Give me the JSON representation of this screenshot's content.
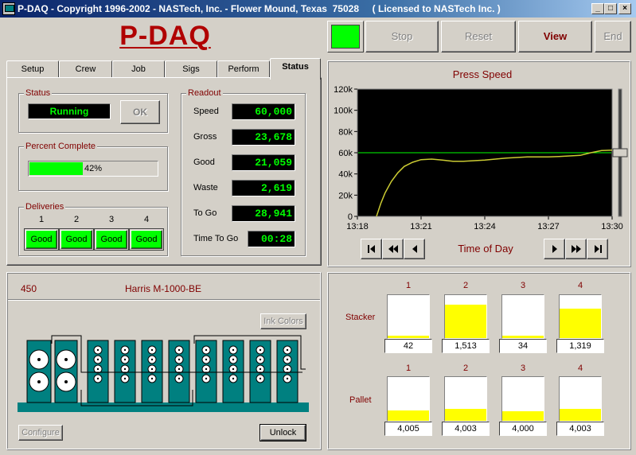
{
  "window": {
    "title": "P-DAQ - Copyright 1996-2002 - NASTech, Inc. - Flower Mound, Texas  75028     ( Licensed to NASTech Inc. )",
    "controls": [
      "minimize-icon",
      "maximize-icon",
      "close-icon"
    ]
  },
  "app_logo": "P-DAQ",
  "toolbar": {
    "indicator_color": "#00ff00",
    "stop": "Stop",
    "reset": "Reset",
    "view": "View",
    "end": "End"
  },
  "tabs": [
    "Setup",
    "Crew",
    "Job",
    "Sigs",
    "Perform",
    "Status"
  ],
  "active_tab": "Status",
  "status": {
    "group_label": "Status",
    "value": "Running",
    "ok_label": "OK"
  },
  "percent": {
    "group_label": "Percent Complete",
    "value": 42,
    "text": "42%"
  },
  "deliveries": {
    "group_label": "Deliveries",
    "items": [
      {
        "number": "1",
        "state": "Good"
      },
      {
        "number": "2",
        "state": "Good"
      },
      {
        "number": "3",
        "state": "Good"
      },
      {
        "number": "4",
        "state": "Good"
      }
    ]
  },
  "readout": {
    "group_label": "Readout",
    "rows": [
      {
        "label": "Speed",
        "value": "60,000"
      },
      {
        "label": "Gross",
        "value": "23,678"
      },
      {
        "label": "Good",
        "value": "21,059"
      },
      {
        "label": "Waste",
        "value": "2,619"
      },
      {
        "label": "To Go",
        "value": "28,941"
      },
      {
        "label": "Time To Go",
        "value": "00:28"
      }
    ]
  },
  "press": {
    "number": "450",
    "model": "Harris M-1000-BE",
    "ink_colors": "Ink Colors",
    "configure": "Configure",
    "unlock": "Unlock",
    "unit_color": "#008080"
  },
  "chart_data": {
    "type": "line",
    "title": "Press Speed",
    "xlabel": "Time of Day",
    "ylabel": "",
    "x_ticks": [
      "13:18",
      "13:21",
      "13:24",
      "13:27",
      "13:30"
    ],
    "y_ticks": [
      "0",
      "20k",
      "40k",
      "60k",
      "80k",
      "100k",
      "120k"
    ],
    "ylim": [
      0,
      120000
    ],
    "xlim_minutes": [
      0,
      12
    ],
    "background": "#000000",
    "grid": false,
    "setpoint": {
      "value": 60000,
      "color": "#00ff00"
    },
    "series": [
      {
        "color": "#cccc33",
        "x_minutes": [
          0.9,
          1.1,
          1.3,
          1.6,
          1.9,
          2.2,
          2.6,
          3.0,
          3.5,
          4.0,
          4.5,
          5.0,
          5.5,
          6.0,
          6.5,
          7.0,
          7.5,
          8.0,
          8.5,
          9.0,
          9.5,
          10.0,
          10.5,
          11.0,
          11.5,
          12.0
        ],
        "values": [
          0,
          12000,
          22000,
          33000,
          41000,
          47000,
          51000,
          53500,
          54000,
          53000,
          52000,
          52000,
          52500,
          53000,
          54000,
          55000,
          55500,
          56000,
          56000,
          56000,
          56500,
          57000,
          57500,
          60000,
          62000,
          62500
        ]
      }
    ]
  },
  "stacker": {
    "label": "Stacker",
    "columns": [
      {
        "number": "1",
        "value": "42",
        "fill": 0.06
      },
      {
        "number": "2",
        "value": "1,513",
        "fill": 0.78
      },
      {
        "number": "3",
        "value": "34",
        "fill": 0.05
      },
      {
        "number": "4",
        "value": "1,319",
        "fill": 0.68
      }
    ]
  },
  "pallet": {
    "label": "Pallet",
    "columns": [
      {
        "number": "1",
        "value": "4,005",
        "fill": 0.24
      },
      {
        "number": "2",
        "value": "4,003",
        "fill": 0.27
      },
      {
        "number": "3",
        "value": "4,000",
        "fill": 0.22
      },
      {
        "number": "4",
        "value": "4,003",
        "fill": 0.27
      }
    ]
  }
}
